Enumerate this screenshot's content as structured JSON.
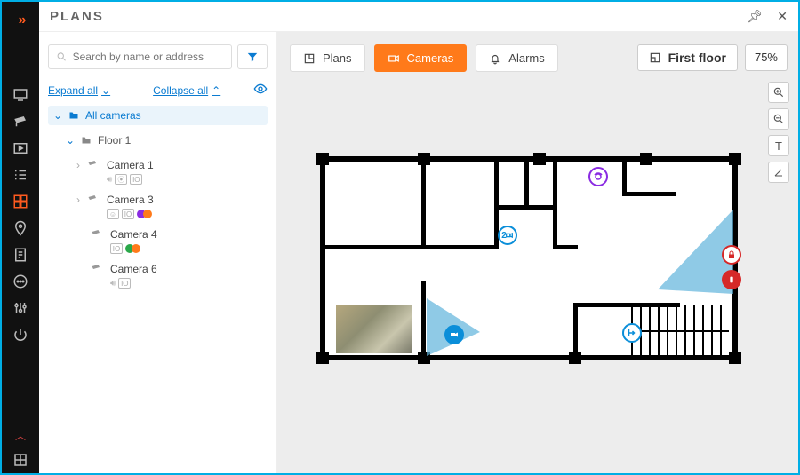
{
  "title": "PLANS",
  "search": {
    "placeholder": "Search by name or address"
  },
  "expand": {
    "expand": "Expand all",
    "collapse": "Collapse all"
  },
  "tree": {
    "root": "All cameras",
    "floor": "Floor 1",
    "cameras": [
      {
        "name": "Camera 1",
        "io": "IO",
        "speaker": true,
        "dots": []
      },
      {
        "name": "Camera 3",
        "io": "IO",
        "smile": true,
        "dots": [
          "#8a2be2",
          "#ff7a1a"
        ]
      },
      {
        "name": "Camera 4",
        "io": "IO",
        "dots": [
          "#2aa84a",
          "#ff7a1a"
        ]
      },
      {
        "name": "Camera 6",
        "io": "IO",
        "speaker": true,
        "dots": []
      }
    ]
  },
  "toolbar": {
    "plans": "Plans",
    "cameras": "Cameras",
    "alarms": "Alarms"
  },
  "floor_label": "First floor",
  "zoom": "75%",
  "plan_marker": "2"
}
